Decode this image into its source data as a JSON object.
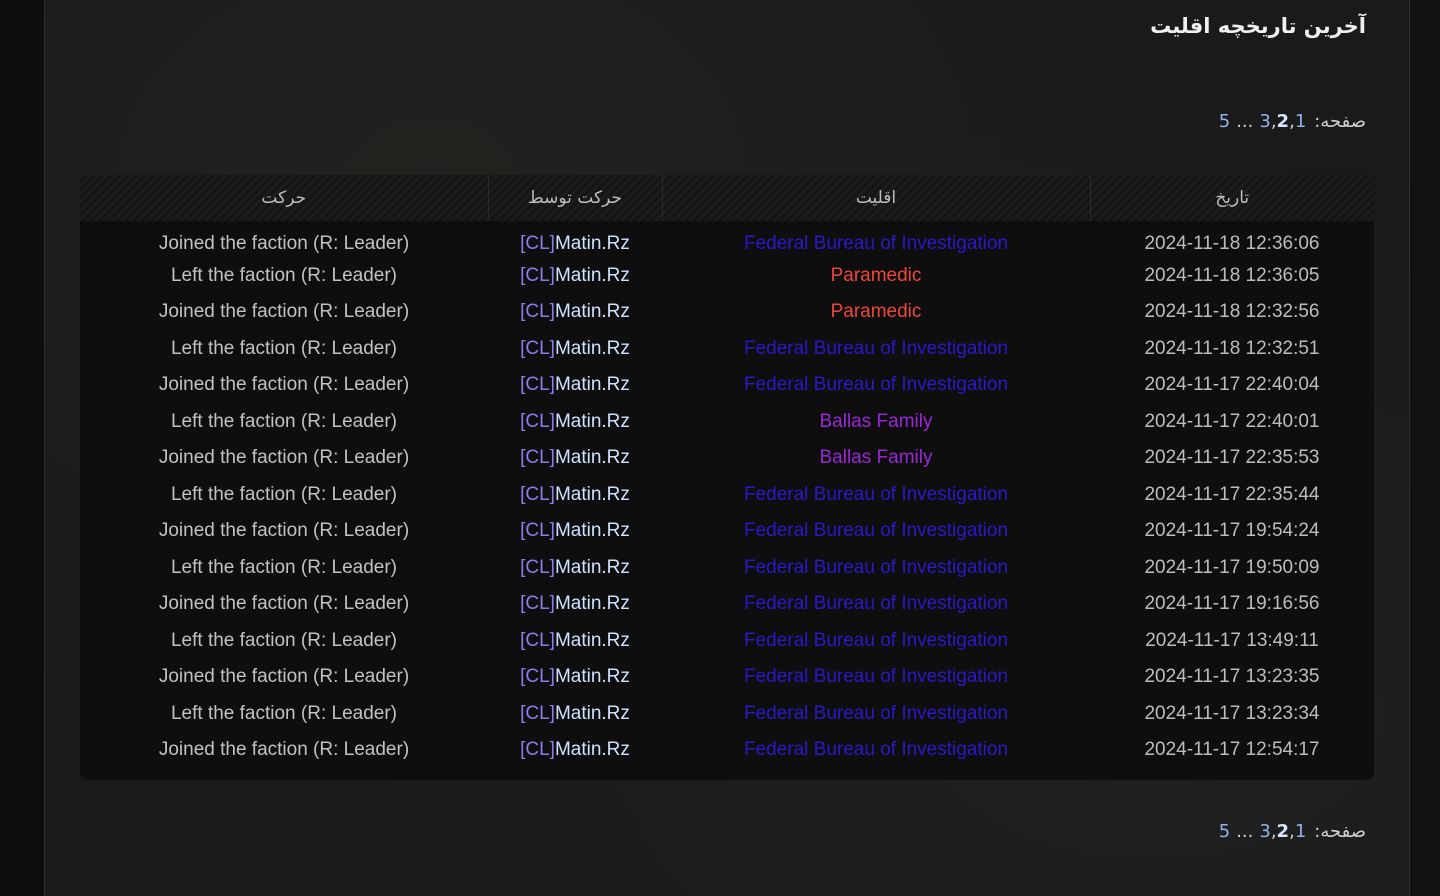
{
  "title": "آخرین تاریخچه اقلیت",
  "pagination": {
    "label": "صفحه:",
    "pages": [
      "1",
      "2",
      "3",
      "...",
      "5"
    ],
    "current": "2"
  },
  "table": {
    "headers": {
      "date": "تاریخ",
      "faction": "اقلیت",
      "actor": "حرکت توسط",
      "action": "حرکت"
    },
    "rows": [
      {
        "date": "2024-11-18 12:36:06",
        "faction": "Federal Bureau of Investigation",
        "faction_color": "#2a19c9",
        "actor_tag": "[CL]",
        "actor_name": "Matin.Rz",
        "action": "Joined the faction (R: Leader)"
      },
      {
        "date": "2024-11-18 12:36:05",
        "faction": "Paramedic",
        "faction_color": "#f0463a",
        "actor_tag": "[CL]",
        "actor_name": "Matin.Rz",
        "action": "Left the faction (R: Leader)"
      },
      {
        "date": "2024-11-18 12:32:56",
        "faction": "Paramedic",
        "faction_color": "#f0463a",
        "actor_tag": "[CL]",
        "actor_name": "Matin.Rz",
        "action": "Joined the faction (R: Leader)"
      },
      {
        "date": "2024-11-18 12:32:51",
        "faction": "Federal Bureau of Investigation",
        "faction_color": "#2a19c9",
        "actor_tag": "[CL]",
        "actor_name": "Matin.Rz",
        "action": "Left the faction (R: Leader)"
      },
      {
        "date": "2024-11-17 22:40:04",
        "faction": "Federal Bureau of Investigation",
        "faction_color": "#2a19c9",
        "actor_tag": "[CL]",
        "actor_name": "Matin.Rz",
        "action": "Joined the faction (R: Leader)"
      },
      {
        "date": "2024-11-17 22:40:01",
        "faction": "Ballas Family",
        "faction_color": "#9b26d9",
        "actor_tag": "[CL]",
        "actor_name": "Matin.Rz",
        "action": "Left the faction (R: Leader)"
      },
      {
        "date": "2024-11-17 22:35:53",
        "faction": "Ballas Family",
        "faction_color": "#9b26d9",
        "actor_tag": "[CL]",
        "actor_name": "Matin.Rz",
        "action": "Joined the faction (R: Leader)"
      },
      {
        "date": "2024-11-17 22:35:44",
        "faction": "Federal Bureau of Investigation",
        "faction_color": "#2a19c9",
        "actor_tag": "[CL]",
        "actor_name": "Matin.Rz",
        "action": "Left the faction (R: Leader)"
      },
      {
        "date": "2024-11-17 19:54:24",
        "faction": "Federal Bureau of Investigation",
        "faction_color": "#2a19c9",
        "actor_tag": "[CL]",
        "actor_name": "Matin.Rz",
        "action": "Joined the faction (R: Leader)"
      },
      {
        "date": "2024-11-17 19:50:09",
        "faction": "Federal Bureau of Investigation",
        "faction_color": "#2a19c9",
        "actor_tag": "[CL]",
        "actor_name": "Matin.Rz",
        "action": "Left the faction (R: Leader)"
      },
      {
        "date": "2024-11-17 19:16:56",
        "faction": "Federal Bureau of Investigation",
        "faction_color": "#2a19c9",
        "actor_tag": "[CL]",
        "actor_name": "Matin.Rz",
        "action": "Joined the faction (R: Leader)"
      },
      {
        "date": "2024-11-17 13:49:11",
        "faction": "Federal Bureau of Investigation",
        "faction_color": "#2a19c9",
        "actor_tag": "[CL]",
        "actor_name": "Matin.Rz",
        "action": "Left the faction (R: Leader)"
      },
      {
        "date": "2024-11-17 13:23:35",
        "faction": "Federal Bureau of Investigation",
        "faction_color": "#2a19c9",
        "actor_tag": "[CL]",
        "actor_name": "Matin.Rz",
        "action": "Joined the faction (R: Leader)"
      },
      {
        "date": "2024-11-17 13:23:34",
        "faction": "Federal Bureau of Investigation",
        "faction_color": "#2a19c9",
        "actor_tag": "[CL]",
        "actor_name": "Matin.Rz",
        "action": "Left the faction (R: Leader)"
      },
      {
        "date": "2024-11-17 12:54:17",
        "faction": "Federal Bureau of Investigation",
        "faction_color": "#2a19c9",
        "actor_tag": "[CL]",
        "actor_name": "Matin.Rz",
        "action": "Joined the faction (R: Leader)"
      }
    ]
  }
}
